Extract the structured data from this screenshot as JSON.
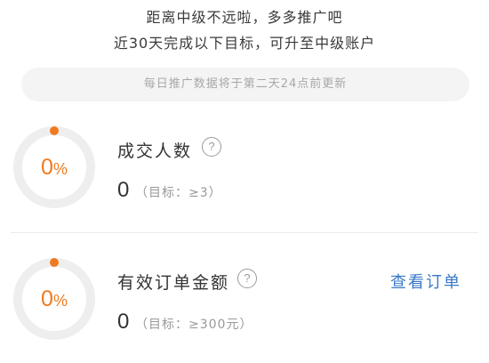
{
  "header": {
    "line1": "距离中级不远啦，多多推广吧",
    "line2": "近30天完成以下目标，可升至中级账户"
  },
  "notice": {
    "text": "每日推广数据将于第二天24点前更新"
  },
  "metrics": [
    {
      "progress_value": "0",
      "progress_unit": "%",
      "progress_fraction": 0,
      "title": "成交人数",
      "help_symbol": "?",
      "value": "0",
      "target": "（目标：≥3）"
    },
    {
      "progress_value": "0",
      "progress_unit": "%",
      "progress_fraction": 0,
      "title": "有效订单金额",
      "help_symbol": "?",
      "value": "0",
      "target": "（目标：≥300元）",
      "action_label": "查看订单"
    }
  ],
  "colors": {
    "accent_orange": "#f07a1f",
    "ring_track": "#eeeeee",
    "link_blue": "#3a78c7",
    "notice_bg": "#f4f4f4"
  },
  "icons": {
    "help": "question-circle-icon",
    "progress": "progress-ring-icon"
  }
}
